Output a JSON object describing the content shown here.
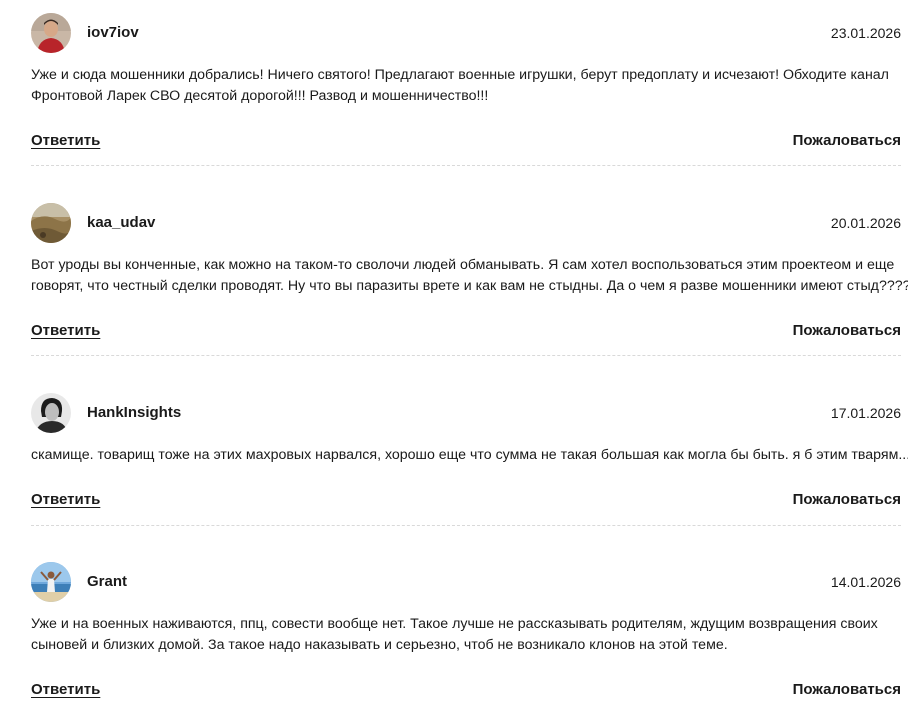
{
  "comments": [
    {
      "username": "iov7iov",
      "date": "23.01.2026",
      "avatar_icon": "user-photo-red-shirt",
      "text_lines": [
        "Уже и сюда мошенники добрались! Ничего святого! Предлагают военные игрушки, берут предоплату и исчезают! Обходите канал",
        "Фронтовой Ларек СВО десятой дорогой!!! Развод и мошенничество!!!"
      ],
      "reply_label": "Ответить",
      "report_label": "Пожаловаться"
    },
    {
      "username": "kaa_udav",
      "date": "20.01.2026",
      "avatar_icon": "user-photo-landscape",
      "text_lines": [
        "Вот уроды вы конченные, как можно на таком-то сволочи людей обманывать. Я сам хотел воспользоваться этим проектеом и еще",
        "говорят, что честный сделки проводят. Ну что вы паразиты врете и как вам не стыдны. Да о чем я разве мошенники имеют стыд?????"
      ],
      "reply_label": "Ответить",
      "report_label": "Пожаловаться"
    },
    {
      "username": "HankInsights",
      "date": "17.01.2026",
      "avatar_icon": "user-photo-bw-portrait",
      "text_lines": [
        "скамище. товарищ тоже на этих махровых нарвался, хорошо еще что сумма не такая большая как могла бы быть. я б этим тварям..."
      ],
      "reply_label": "Ответить",
      "report_label": "Пожаловаться"
    },
    {
      "username": "Grant",
      "date": "14.01.2026",
      "avatar_icon": "user-photo-beach",
      "text_lines": [
        "Уже и на военных наживаются, ппц, совести вообще нет. Такое лучше не рассказывать родителям, ждущим возвращения своих",
        "сыновей и близких домой. За такое надо наказывать и серьезно, чтоб не возникало клонов на этой теме."
      ],
      "reply_label": "Ответить",
      "report_label": "Пожаловаться"
    }
  ]
}
